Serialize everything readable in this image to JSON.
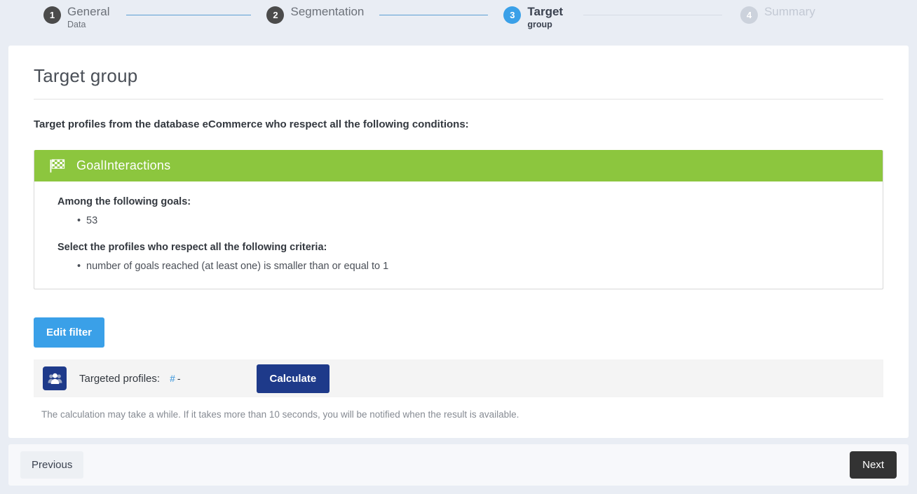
{
  "stepper": {
    "steps": [
      {
        "number": "1",
        "title": "General",
        "sub": "Data",
        "state": "done"
      },
      {
        "number": "2",
        "title": "Segmentation",
        "sub": "",
        "state": "done"
      },
      {
        "number": "3",
        "title": "Target",
        "sub": "group",
        "state": "active"
      },
      {
        "number": "4",
        "title": "Summary",
        "sub": "",
        "state": "todo"
      }
    ]
  },
  "page": {
    "title": "Target group",
    "intro": "Target profiles from the database eCommerce who respect all the following conditions:"
  },
  "filter": {
    "icon": "checkered-flag-icon",
    "header_title": "GoalInteractions",
    "goals_label": "Among the following goals:",
    "goals": [
      "53"
    ],
    "criteria_label": "Select the profiles who respect all the following criteria:",
    "criteria": [
      "number of goals reached (at least one) is smaller than or equal to 1"
    ],
    "edit_button": "Edit filter"
  },
  "profiles": {
    "icon": "people-icon",
    "label": "Targeted profiles:",
    "hash": "#",
    "value": "-",
    "calculate_button": "Calculate",
    "note": "The calculation may take a while. If it takes more than 10 seconds, you will be notified when the result is available."
  },
  "footer": {
    "previous": "Previous",
    "next": "Next"
  },
  "colors": {
    "page_bg": "#e9edf4",
    "accent_blue": "#3aa0e8",
    "panel_green": "#8cc63e",
    "navy": "#1e3a8a",
    "next_dark": "#333333"
  }
}
